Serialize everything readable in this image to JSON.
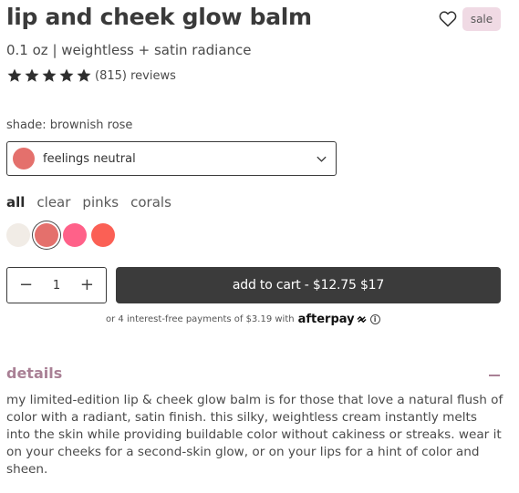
{
  "product": {
    "title": "lip and cheek glow balm",
    "badge": "sale",
    "subtitle": "0.1 oz | weightless + satin radiance",
    "rating": 5,
    "review_count": "(815) reviews"
  },
  "shade": {
    "label": "shade: brownish rose",
    "selected_name": "feelings neutral",
    "selected_color": "#e4706c",
    "filters": [
      "all",
      "clear",
      "pinks",
      "corals"
    ],
    "active_filter": "all",
    "swatches": [
      "#f1ece6",
      "#e4706c",
      "#ff6189",
      "#fb6055"
    ]
  },
  "cart": {
    "quantity": "1",
    "minus": "−",
    "plus": "+",
    "button_label": "add to cart - $12.75 $17"
  },
  "payment": {
    "text": "or 4 interest-free payments of $3.19 with",
    "brand": "afterpay",
    "info": "i"
  },
  "details": {
    "heading": "details",
    "body": "my limited-edition lip & cheek glow balm is for those that love a natural flush of color with a radiant, satin finish. this silky, weightless cream instantly melts into the skin while providing buildable color without cakiness or streaks. wear it on your cheeks for a second-skin glow, or on your lips for a hint of color and sheen."
  },
  "colors": {
    "accent": "#a98095",
    "button": "#3b3b3b",
    "badge_bg": "#f0dae4"
  }
}
